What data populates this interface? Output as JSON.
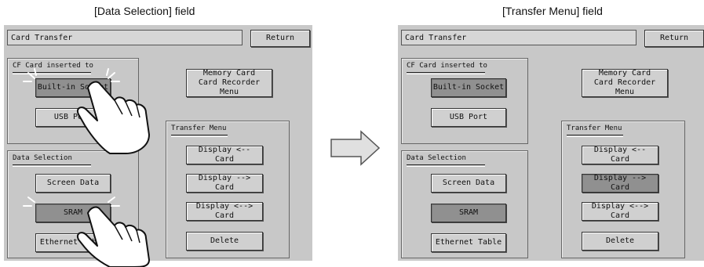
{
  "captions": {
    "left": "[Data Selection] field",
    "right": "[Transfer Menu] field"
  },
  "left_panel": {
    "title": "Card Transfer",
    "return_label": "Return",
    "cf_group_label": "CF Card inserted to",
    "builtin_socket": "Built-in Socket",
    "usb_port": "USB Port",
    "memory_card_line1": "Memory Card",
    "memory_card_line2": "Card Recorder Menu",
    "data_group_label": "Data Selection",
    "screen_data": "Screen Data",
    "sram": "SRAM",
    "ethernet_table": "Ethernet Table",
    "transfer_group_label": "Transfer Menu",
    "display_from_card": "Display <-- Card",
    "display_to_card": "Display --> Card",
    "display_both": "Display <--> Card",
    "delete": "Delete"
  },
  "right_panel": {
    "title": "Card Transfer",
    "return_label": "Return",
    "cf_group_label": "CF Card inserted to",
    "builtin_socket": "Built-in Socket",
    "usb_port": "USB Port",
    "memory_card_line1": "Memory Card",
    "memory_card_line2": "Card Recorder Menu",
    "data_group_label": "Data Selection",
    "screen_data": "Screen Data",
    "sram": "SRAM",
    "ethernet_table": "Ethernet Table",
    "transfer_group_label": "Transfer Menu",
    "display_from_card": "Display <-- Card",
    "display_to_card": "Display --> Card",
    "display_both": "Display <--> Card",
    "delete": "Delete"
  },
  "colors": {
    "panel_bg": "#c8c8c8",
    "selected_button": "#909090",
    "normal_button": "#d0d0d0"
  },
  "icons": [
    "pointing-hand-icon",
    "right-arrow-icon"
  ]
}
